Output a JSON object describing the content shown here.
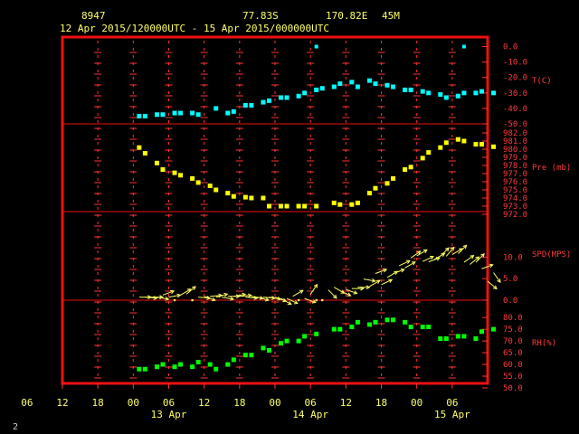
{
  "header": {
    "station": "8947",
    "lat": "77.83S",
    "lon": "170.82E",
    "elev": "45M",
    "range": "12 Apr 2015/120000UTC - 15 Apr 2015/000000UTC"
  },
  "corner_label": "2",
  "x_axis": {
    "hour_labels": [
      "06",
      "12",
      "18",
      "00",
      "06",
      "12",
      "18",
      "00",
      "06",
      "12",
      "18",
      "00",
      "06"
    ],
    "date_labels": [
      "13 Apr",
      "14 Apr",
      "15 Apr"
    ]
  },
  "colors": {
    "frame": "#ee1111",
    "ticks": "#ff3333",
    "axis_text": "#ffff66",
    "temp": "#00ffff",
    "pressure": "#ffff00",
    "wind": "#ffff66",
    "rh": "#00ff00"
  },
  "chart_data": [
    {
      "type": "scatter",
      "ylabel": "T(C)",
      "ylim": [
        -50,
        5
      ],
      "yticks": [
        "0.0",
        "-10.0",
        "-20.0",
        "-30.0",
        "-40.0",
        "-50.0"
      ],
      "x": [
        13,
        14,
        16,
        17,
        19,
        20,
        22,
        23,
        26,
        28,
        29,
        31,
        32,
        34,
        35,
        37,
        38,
        40,
        41,
        43,
        44,
        46,
        47,
        49,
        50,
        52,
        53,
        55,
        56,
        58,
        59,
        61,
        62,
        64,
        65,
        67,
        68,
        70,
        71,
        73
      ],
      "values": [
        -45,
        -45,
        -44,
        -44,
        -43,
        -43,
        -43,
        -44,
        -40,
        -43,
        -42,
        -38,
        -38,
        -36,
        -35,
        -33,
        -33,
        -32,
        -30,
        -28,
        -27,
        -26,
        -24,
        -23,
        -26,
        -22,
        -24,
        -25,
        -26,
        -28,
        -28,
        -29,
        -30,
        -31,
        -33,
        -32,
        -30,
        -30,
        -29,
        -30
      ],
      "outliers": [
        {
          "x": 43,
          "y": 0
        },
        {
          "x": 68,
          "y": 0
        }
      ]
    },
    {
      "type": "scatter",
      "ylabel": "Pre (mb)",
      "ylim": [
        972,
        982
      ],
      "yticks": [
        "982.0",
        "981.0",
        "980.0",
        "979.0",
        "978.0",
        "977.0",
        "976.0",
        "975.0",
        "974.0",
        "973.0",
        "972.0"
      ],
      "x": [
        13,
        14,
        16,
        17,
        19,
        20,
        22,
        23,
        25,
        26,
        28,
        29,
        31,
        32,
        34,
        35,
        37,
        38,
        40,
        41,
        43,
        46,
        47,
        49,
        50,
        52,
        53,
        55,
        56,
        58,
        59,
        61,
        62,
        64,
        65,
        67,
        68,
        70,
        71,
        73
      ],
      "values": [
        980.2,
        979.5,
        978.3,
        977.5,
        977.1,
        976.8,
        976.4,
        975.9,
        975.5,
        975.0,
        974.6,
        974.2,
        974.1,
        974.0,
        974.0,
        973.0,
        973.0,
        973.0,
        973.0,
        973.0,
        973.0,
        973.4,
        973.2,
        973.2,
        973.4,
        974.6,
        975.2,
        975.8,
        976.4,
        977.5,
        977.8,
        978.9,
        979.6,
        980.2,
        980.8,
        981.2,
        981.0,
        980.6,
        980.6,
        980.3
      ]
    },
    {
      "type": "scatter",
      "ylabel": "SPD(MPS)",
      "ylim": [
        0,
        14.7
      ],
      "yticks": [
        "10.0",
        "5.0",
        "0.0"
      ],
      "x": [
        13,
        14,
        15,
        16,
        17,
        18,
        19,
        20,
        21,
        22,
        23,
        24,
        25,
        26,
        27,
        28,
        29,
        30,
        31,
        32,
        33,
        34,
        35,
        36,
        37,
        38,
        39,
        40,
        41,
        42,
        43,
        44,
        45,
        46,
        47,
        48,
        49,
        50,
        51,
        52,
        53,
        54,
        55,
        56,
        57,
        58,
        59,
        60,
        61,
        62,
        63,
        64,
        65,
        66,
        67,
        68,
        69,
        70,
        71,
        72,
        73
      ],
      "values": [
        0.7,
        0.7,
        0.7,
        0.7,
        1.2,
        0.7,
        0,
        1.2,
        1.4,
        0,
        0.7,
        0.9,
        0.9,
        0.7,
        0.7,
        0.9,
        0.9,
        0.9,
        0.7,
        0.9,
        0.7,
        0.7,
        0.7,
        0.7,
        0.4,
        0.4,
        0.9,
        0,
        0.4,
        1.4,
        0,
        0,
        2.4,
        3.0,
        2.2,
        2.5,
        2.7,
        3.0,
        4.9,
        3.2,
        6.2,
        3.6,
        5.3,
        6.2,
        8.0,
        7.5,
        9.8,
        10.3,
        9.0,
        8.9,
        9.5,
        10.2,
        10.2,
        10.6,
        10.8,
        8.8,
        8.3,
        8.8,
        7.3,
        4.4,
        6.4
      ],
      "directions": [
        90,
        95,
        90,
        100,
        70,
        80,
        0,
        60,
        50,
        0,
        95,
        110,
        85,
        75,
        100,
        90,
        80,
        85,
        95,
        100,
        105,
        95,
        100,
        110,
        120,
        115,
        60,
        0,
        110,
        35,
        0,
        0,
        135,
        120,
        115,
        110,
        90,
        90,
        100,
        60,
        70,
        65,
        60,
        70,
        65,
        60,
        55,
        60,
        65,
        70,
        60,
        45,
        40,
        60,
        45,
        55,
        50,
        45,
        70,
        130,
        145
      ]
    },
    {
      "type": "scatter",
      "ylabel": "RH(%)",
      "ylim": [
        50,
        82
      ],
      "yticks": [
        "80.0",
        "75.0",
        "70.0",
        "65.0",
        "60.0",
        "55.0",
        "50.0"
      ],
      "x": [
        13,
        14,
        16,
        17,
        19,
        20,
        22,
        23,
        25,
        26,
        28,
        29,
        31,
        32,
        34,
        35,
        37,
        38,
        40,
        41,
        43,
        46,
        47,
        49,
        50,
        52,
        53,
        55,
        56,
        58,
        59,
        61,
        62,
        64,
        65,
        67,
        68,
        70,
        71,
        73
      ],
      "values": [
        58,
        58,
        59,
        60,
        59,
        60,
        59,
        61,
        60,
        58,
        60,
        62,
        64,
        64,
        67,
        66,
        69,
        70,
        70,
        72,
        73,
        75,
        75,
        76,
        78,
        77,
        78,
        79,
        79,
        78,
        76,
        76,
        76,
        71,
        71,
        72,
        72,
        71,
        74,
        75
      ]
    }
  ]
}
